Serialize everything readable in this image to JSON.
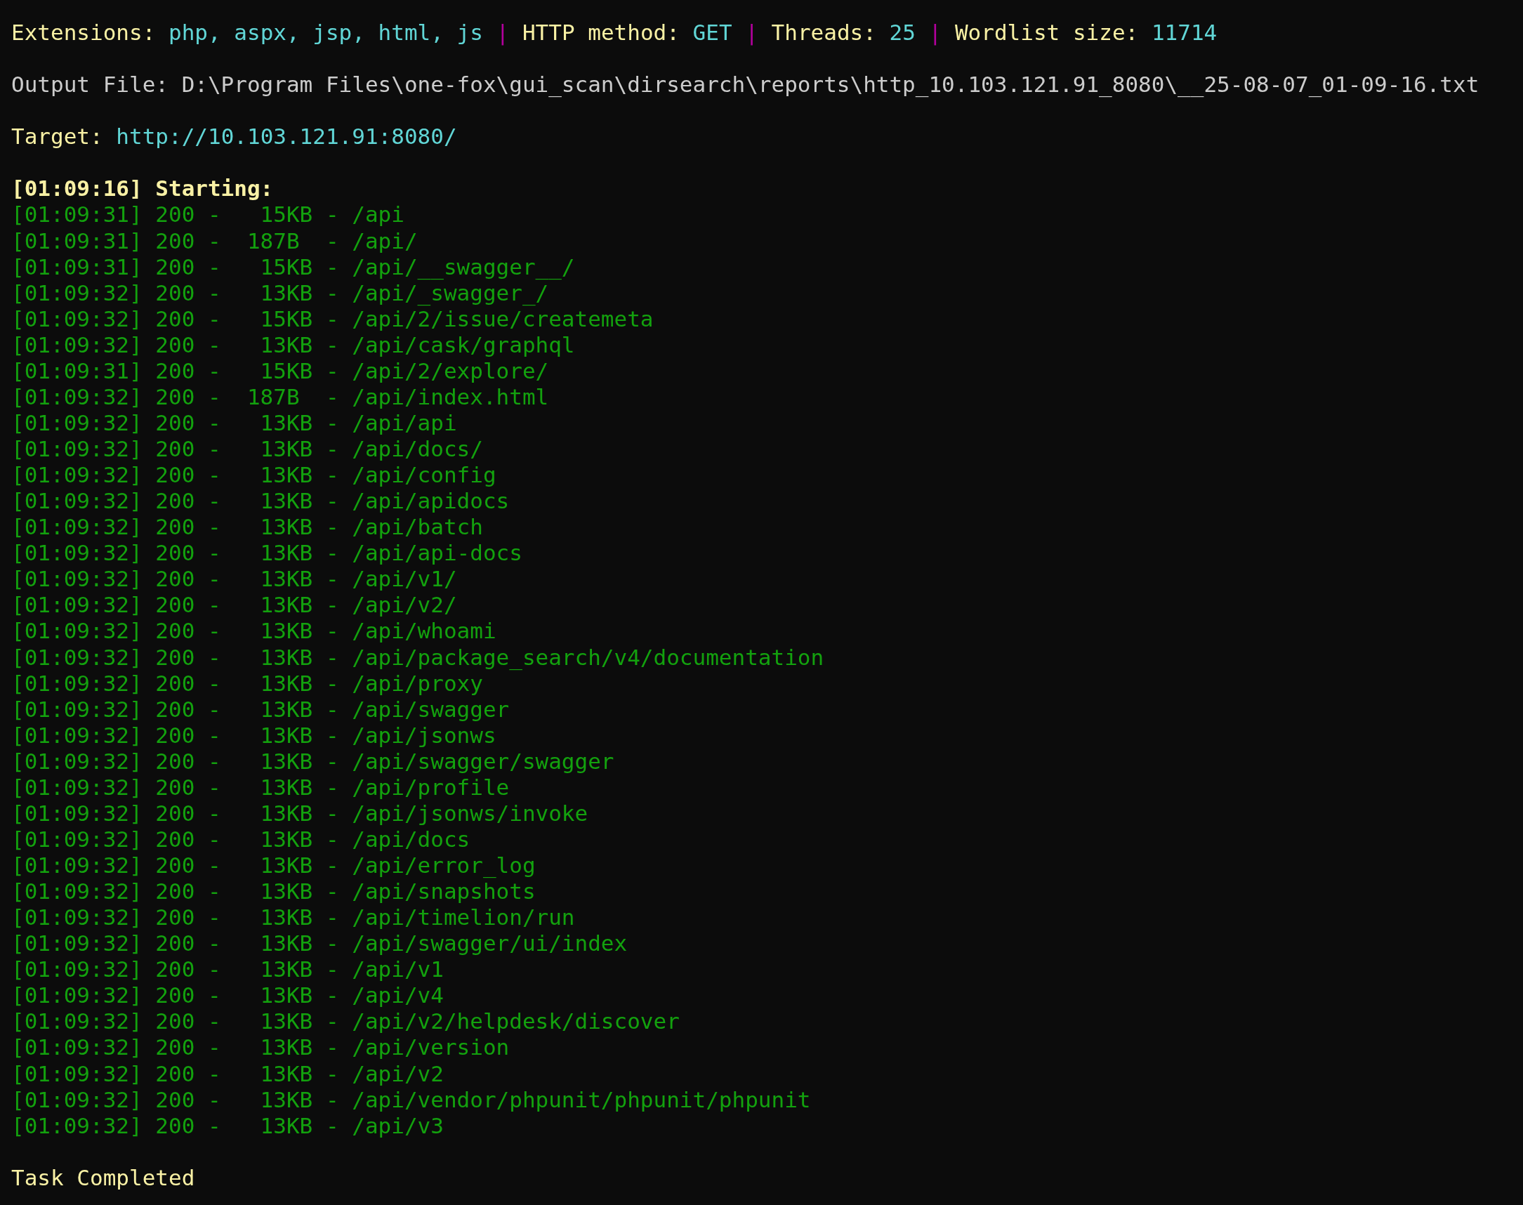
{
  "header": [
    {
      "kind": "label",
      "text": "Extensions:"
    },
    {
      "kind": "value",
      "text": "php, aspx, jsp, html, js"
    },
    {
      "kind": "separator",
      "text": "|"
    },
    {
      "kind": "label",
      "text": "HTTP method:"
    },
    {
      "kind": "value",
      "text": "GET"
    },
    {
      "kind": "separator",
      "text": "|"
    },
    {
      "kind": "label",
      "text": "Threads:"
    },
    {
      "kind": "value",
      "text": "25"
    },
    {
      "kind": "separator",
      "text": "|"
    },
    {
      "kind": "label",
      "text": "Wordlist size:"
    },
    {
      "kind": "value",
      "text": "11714"
    }
  ],
  "output_file": "Output File: D:\\Program Files\\one-fox\\gui_scan\\dirsearch\\reports\\http_10.103.121.91_8080\\__25-08-07_01-09-16.txt",
  "target": {
    "label": "Target:",
    "value": "http://10.103.121.91:8080/"
  },
  "start": "[01:09:16] Starting:",
  "results": [
    "[01:09:31] 200 -   15KB - /api",
    "[01:09:31] 200 -  187B  - /api/",
    "[01:09:31] 200 -   15KB - /api/__swagger__/",
    "[01:09:32] 200 -   13KB - /api/_swagger_/",
    "[01:09:32] 200 -   15KB - /api/2/issue/createmeta",
    "[01:09:32] 200 -   13KB - /api/cask/graphql",
    "[01:09:31] 200 -   15KB - /api/2/explore/",
    "[01:09:32] 200 -  187B  - /api/index.html",
    "[01:09:32] 200 -   13KB - /api/api",
    "[01:09:32] 200 -   13KB - /api/docs/",
    "[01:09:32] 200 -   13KB - /api/config",
    "[01:09:32] 200 -   13KB - /api/apidocs",
    "[01:09:32] 200 -   13KB - /api/batch",
    "[01:09:32] 200 -   13KB - /api/api-docs",
    "[01:09:32] 200 -   13KB - /api/v1/",
    "[01:09:32] 200 -   13KB - /api/v2/",
    "[01:09:32] 200 -   13KB - /api/whoami",
    "[01:09:32] 200 -   13KB - /api/package_search/v4/documentation",
    "[01:09:32] 200 -   13KB - /api/proxy",
    "[01:09:32] 200 -   13KB - /api/swagger",
    "[01:09:32] 200 -   13KB - /api/jsonws",
    "[01:09:32] 200 -   13KB - /api/swagger/swagger",
    "[01:09:32] 200 -   13KB - /api/profile",
    "[01:09:32] 200 -   13KB - /api/jsonws/invoke",
    "[01:09:32] 200 -   13KB - /api/docs",
    "[01:09:32] 200 -   13KB - /api/error_log",
    "[01:09:32] 200 -   13KB - /api/snapshots",
    "[01:09:32] 200 -   13KB - /api/timelion/run",
    "[01:09:32] 200 -   13KB - /api/swagger/ui/index",
    "[01:09:32] 200 -   13KB - /api/v1",
    "[01:09:32] 200 -   13KB - /api/v4",
    "[01:09:32] 200 -   13KB - /api/v2/helpdesk/discover",
    "[01:09:32] 200 -   13KB - /api/version",
    "[01:09:32] 200 -   13KB - /api/v2",
    "[01:09:32] 200 -   13KB - /api/vendor/phpunit/phpunit/phpunit",
    "[01:09:32] 200 -   13KB - /api/v3"
  ],
  "status": "Task Completed"
}
